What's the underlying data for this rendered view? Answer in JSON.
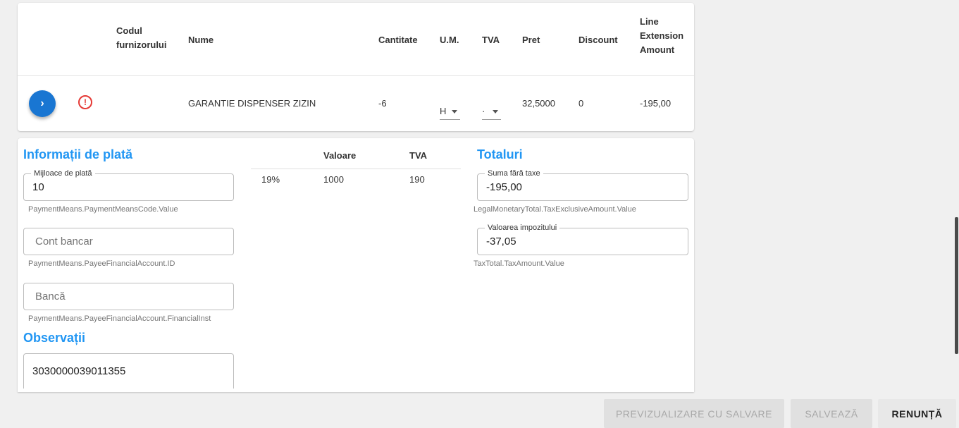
{
  "lines_table": {
    "headers": {
      "supplier_code": "Codul furnizorului",
      "name": "Nume",
      "quantity": "Cantitate",
      "unit": "U.M.",
      "vat": "TVA",
      "price": "Pret",
      "discount": "Discount",
      "line_extension": "Line Extension Amount"
    },
    "rows": [
      {
        "supplier_code": "",
        "name": "GARANTIE DISPENSER ZIZIN",
        "quantity": "-6",
        "unit": "H",
        "vat": "·",
        "price": "32,5000",
        "discount": "0",
        "line_extension": "-195,00"
      }
    ]
  },
  "payment": {
    "title": "Informații de plată",
    "means": {
      "label": "Mijloace de plată",
      "value": "10",
      "helper": "PaymentMeans.PaymentMeansCode.Value"
    },
    "account": {
      "placeholder": "Cont bancar",
      "helper": "PaymentMeans.PayeeFinancialAccount.ID"
    },
    "bank": {
      "placeholder": "Bancă",
      "helper": "PaymentMeans.PayeeFinancialAccount.FinancialInst"
    }
  },
  "vat_breakdown": {
    "headers": {
      "value": "Valoare",
      "vat": "TVA"
    },
    "rows": [
      {
        "rate": "19%",
        "value": "1000",
        "vat": "190"
      }
    ]
  },
  "totals": {
    "title": "Totaluri",
    "tax_exclusive": {
      "label": "Suma fără taxe",
      "value": "-195,00",
      "helper": "LegalMonetaryTotal.TaxExclusiveAmount.Value"
    },
    "tax_amount": {
      "label": "Valoarea impozitului",
      "value": "-37,05",
      "helper": "TaxTotal.TaxAmount.Value"
    }
  },
  "notes": {
    "title": "Observații",
    "value": "3030000039011355"
  },
  "actions": {
    "preview_save": "PREVIZUALIZARE CU SALVARE",
    "save": "SALVEAZĂ",
    "cancel": "RENUNȚĂ"
  },
  "icons": {
    "expand": "chevron-right-icon",
    "warning": "alert-circle-icon",
    "dropdown": "caret-down-icon"
  },
  "colors": {
    "accent": "#2196f3",
    "expand_button": "#1976d2",
    "warning": "#e53935"
  }
}
